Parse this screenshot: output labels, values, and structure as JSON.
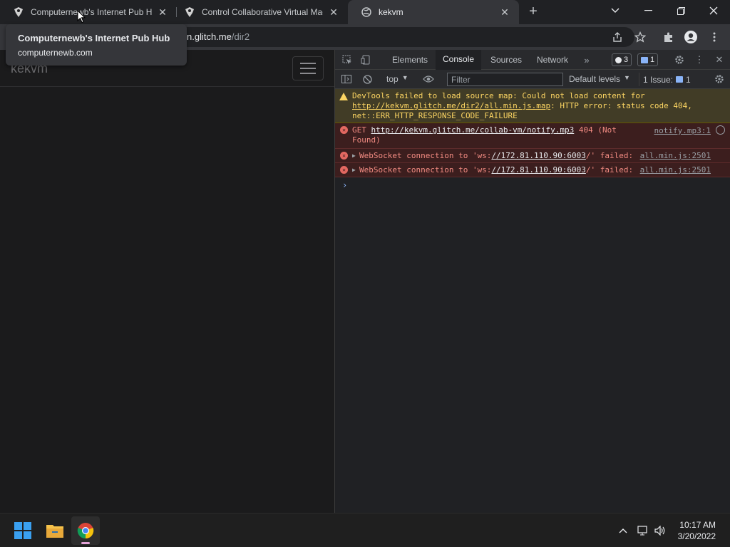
{
  "tabs": [
    {
      "title": "Computernewb's Internet Pub Hu",
      "active": false
    },
    {
      "title": "Control Collaborative Virtual Mac",
      "active": false
    },
    {
      "title": "kekvm",
      "active": true
    }
  ],
  "tooltip": {
    "title": "Computernewb's Internet Pub Hub",
    "domain": "computernewb.com"
  },
  "address": {
    "host": "n.glitch.me",
    "path": "/dir2"
  },
  "page": {
    "brand": "kekvm"
  },
  "devtools": {
    "tabs": [
      "Elements",
      "Console",
      "Sources",
      "Network"
    ],
    "active_tab": "Console",
    "badges": {
      "errors": "3",
      "messages": "1"
    },
    "context": "top",
    "filter_placeholder": "Filter",
    "levels": "Default levels",
    "issues_label": "1 Issue:",
    "issues_count": "1",
    "messages": [
      {
        "level": "warning",
        "prefix": "DevTools failed to load source map: Could not load content for ",
        "link": "http://kekvm.glitch.me/dir2/all.min.js.map",
        "suffix": ": HTTP error: status code 404, net::ERR_HTTP_RESPONSE_CODE_FAILURE"
      },
      {
        "level": "error",
        "prefix": "GET ",
        "link": "http://kekvm.glitch.me/collab-vm/notify.mp3",
        "suffix": " 404 (Not Found)",
        "source": "notify.mp3:1"
      },
      {
        "level": "error",
        "prefix": "WebSocket connection to 'ws:",
        "link": "//172.81.110.90:6003",
        "suffix": "/' failed:",
        "source": "all.min.js:2501"
      },
      {
        "level": "error",
        "prefix": "WebSocket connection to 'ws:",
        "link": "//172.81.110.90:6003",
        "suffix": "/' failed:",
        "source": "all.min.js:2501"
      }
    ]
  },
  "taskbar": {
    "time": "10:17 AM",
    "date": "3/20/2022"
  },
  "colors": {
    "accent_blue": "#8ab4f8",
    "error_red": "#f28b82",
    "warn_yellow": "#fdd663"
  }
}
